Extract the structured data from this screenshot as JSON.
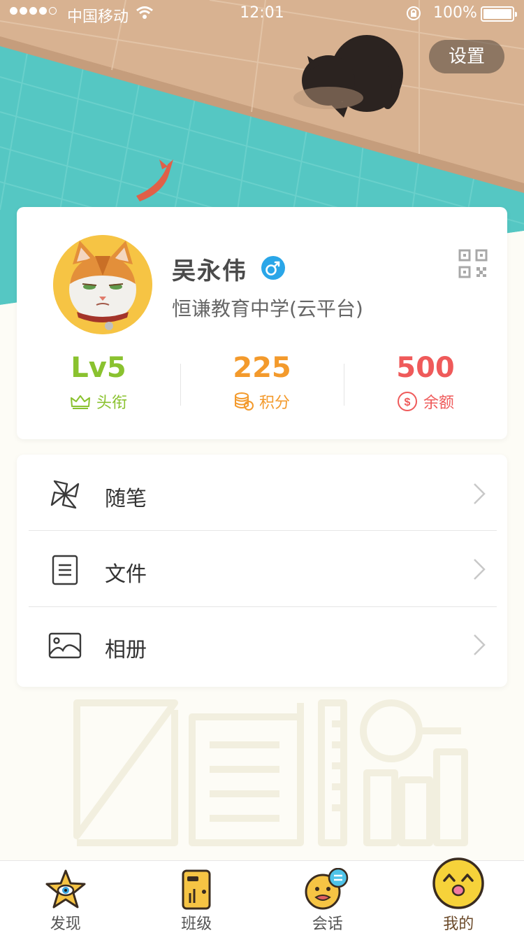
{
  "status_bar": {
    "carrier": "中国移动",
    "time": "12:01",
    "battery": "100%"
  },
  "header": {
    "settings_label": "设置"
  },
  "profile": {
    "name": "吴永伟",
    "school": "恒谦教育中学(云平台)",
    "gender_icon": "male-icon",
    "stats": [
      {
        "value": "Lv5",
        "label": "头衔",
        "icon": "crown-icon",
        "color": "#8ac22f"
      },
      {
        "value": "225",
        "label": "积分",
        "icon": "coins-icon",
        "color": "#f39a2c"
      },
      {
        "value": "500",
        "label": "余额",
        "icon": "dollar-icon",
        "color": "#ef5a5a"
      }
    ]
  },
  "menu": {
    "items": [
      {
        "label": "随笔",
        "icon": "pinwheel-icon"
      },
      {
        "label": "文件",
        "icon": "document-icon"
      },
      {
        "label": "相册",
        "icon": "photo-icon"
      }
    ]
  },
  "tabbar": {
    "tabs": [
      {
        "label": "发现",
        "icon": "star-eye-icon",
        "active": false
      },
      {
        "label": "班级",
        "icon": "door-icon",
        "active": false
      },
      {
        "label": "会话",
        "icon": "chat-face-icon",
        "active": false
      },
      {
        "label": "我的",
        "icon": "happy-face-icon",
        "active": true
      }
    ]
  },
  "colors": {
    "pool": "#56c8c4",
    "deck": "#d9b391",
    "accent_yellow": "#f6c444"
  }
}
